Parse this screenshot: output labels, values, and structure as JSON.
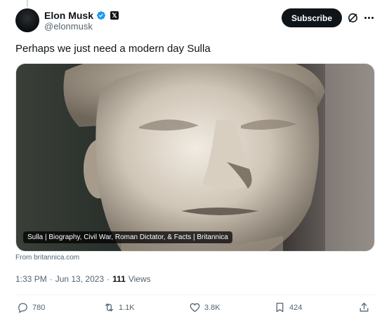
{
  "author": {
    "display_name": "Elon Musk",
    "handle": "@elonmusk",
    "affiliate_badge": "𝕏"
  },
  "header": {
    "subscribe_label": "Subscribe",
    "icons": [
      "verified-badge-icon",
      "x-affiliate-icon",
      "grok-icon",
      "more-icon"
    ]
  },
  "tweet": {
    "text": "Perhaps we just need a modern day Sulla",
    "card": {
      "caption": "Sulla | Biography, Civil War, Roman Dictator, & Facts | Britannica",
      "source": "From britannica.com"
    },
    "meta": {
      "time": "1:33 PM",
      "separator1": "·",
      "date": "Jun 13, 2023",
      "separator2": "·",
      "views_count": "111",
      "views_label": "Views"
    }
  },
  "actions": {
    "replies": "780",
    "reposts": "1.1K",
    "likes": "3.8K",
    "bookmarks": "424"
  },
  "colors": {
    "text_primary": "#0f1419",
    "text_secondary": "#536471",
    "verified_blue": "#1d9bf0",
    "divider": "#eff3f4"
  }
}
